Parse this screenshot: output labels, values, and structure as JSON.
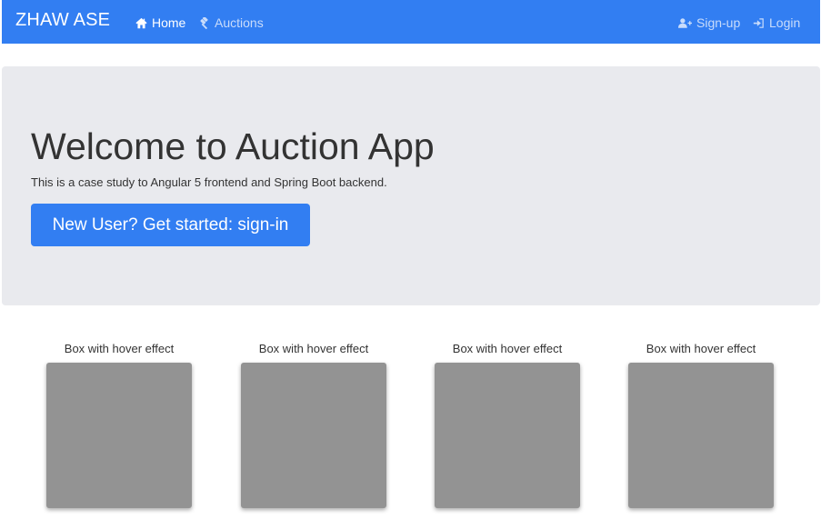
{
  "navbar": {
    "brand": "ZHAW ASE",
    "bg_color": "#327ef2",
    "items": [
      {
        "label": "Home",
        "icon": "home-icon",
        "active": true
      },
      {
        "label": "Auctions",
        "icon": "gavel-icon",
        "active": false
      }
    ],
    "right_items": [
      {
        "label": "Sign-up",
        "icon": "user-plus-icon"
      },
      {
        "label": "Login",
        "icon": "sign-in-icon"
      }
    ]
  },
  "jumbotron": {
    "title": "Welcome to Auction App",
    "lead": "This is a case study to Angular 5 frontend and Spring Boot backend.",
    "button_label": "New User? Get started: sign-in",
    "bg_color": "#e9eaee"
  },
  "boxes": [
    {
      "label": "Box with hover effect"
    },
    {
      "label": "Box with hover effect"
    },
    {
      "label": "Box with hover effect"
    },
    {
      "label": "Box with hover effect"
    }
  ]
}
